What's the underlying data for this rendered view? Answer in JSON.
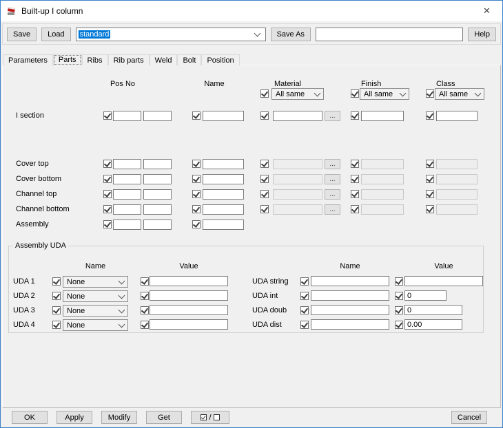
{
  "window": {
    "title": "Built-up I column",
    "close_icon": "✕"
  },
  "toolbar": {
    "save": "Save",
    "load": "Load",
    "profile_value": "standard",
    "save_as": "Save As",
    "save_as_value": "",
    "help": "Help"
  },
  "tabs": [
    {
      "label": "Parameters"
    },
    {
      "label": "Parts"
    },
    {
      "label": "Ribs"
    },
    {
      "label": "Rib parts"
    },
    {
      "label": "Weld"
    },
    {
      "label": "Bolt"
    },
    {
      "label": "Position"
    }
  ],
  "parts": {
    "headers": {
      "pos_no": "Pos No",
      "name": "Name",
      "material": "Material",
      "finish": "Finish",
      "class": "Class"
    },
    "all_same": "All same",
    "browse": "...",
    "rows": [
      {
        "label": "I section"
      },
      {
        "label": "Cover top"
      },
      {
        "label": "Cover bottom"
      },
      {
        "label": "Channel top"
      },
      {
        "label": "Channel bottom"
      },
      {
        "label": "Assembly"
      }
    ]
  },
  "assembly_uda": {
    "title": "Assembly UDA",
    "headers": {
      "name": "Name",
      "value": "Value"
    },
    "left_rows": [
      {
        "label": "UDA 1",
        "name": "None",
        "value": ""
      },
      {
        "label": "UDA 2",
        "name": "None",
        "value": ""
      },
      {
        "label": "UDA 3",
        "name": "None",
        "value": ""
      },
      {
        "label": "UDA 4",
        "name": "None",
        "value": ""
      }
    ],
    "right_rows": [
      {
        "label": "UDA string",
        "name": "",
        "value": ""
      },
      {
        "label": "UDA int",
        "name": "",
        "value": "0"
      },
      {
        "label": "UDA doub",
        "name": "",
        "value": "0"
      },
      {
        "label": "UDA dist",
        "name": "",
        "value": "0.00"
      }
    ]
  },
  "footer": {
    "ok": "OK",
    "apply": "Apply",
    "modify": "Modify",
    "get": "Get",
    "toggle_separator": "/",
    "cancel": "Cancel"
  }
}
